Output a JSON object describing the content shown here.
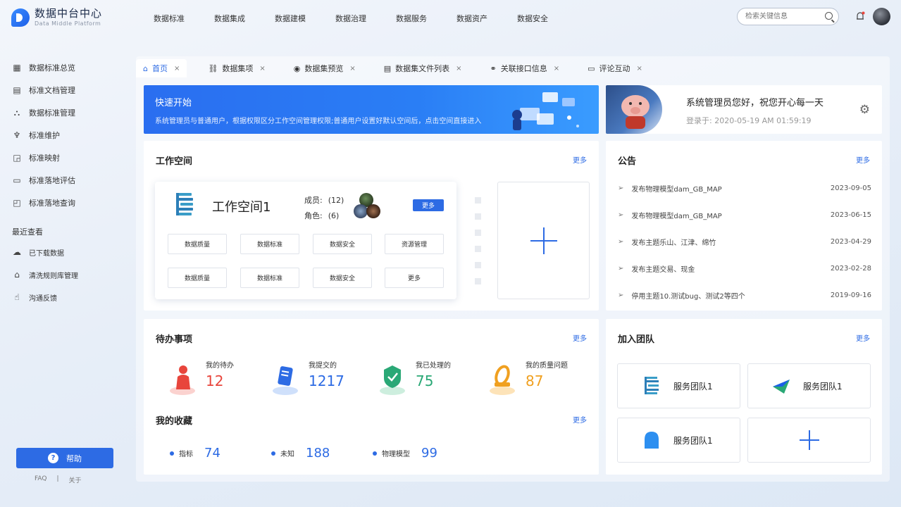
{
  "header": {
    "app_title": "数据中台中心",
    "app_subtitle": "Data Middle Platform",
    "nav": [
      "数据标准",
      "数据集成",
      "数据建模",
      "数据治理",
      "数据服务",
      "数据资产",
      "数据安全"
    ],
    "search_placeholder": "检索关键信息"
  },
  "sidebar": {
    "items": [
      {
        "label": "数据标准总览",
        "icon": "overview-icon"
      },
      {
        "label": "标准文档管理",
        "icon": "document-icon"
      },
      {
        "label": "数据标准管理",
        "icon": "hierarchy-icon"
      },
      {
        "label": "标准维护",
        "icon": "maintenance-icon"
      },
      {
        "label": "标准映射",
        "icon": "mapping-icon"
      },
      {
        "label": "标准落地评估",
        "icon": "comment-icon"
      },
      {
        "label": "标准落地查询",
        "icon": "query-icon"
      }
    ],
    "recent_title": "最近查看",
    "recent": [
      {
        "label": "已下载数据",
        "icon": "cloud-download-icon"
      },
      {
        "label": "清洗规则库管理",
        "icon": "building-icon"
      },
      {
        "label": "沟通反馈",
        "icon": "thumbs-up-icon"
      }
    ],
    "help_label": "帮助",
    "faq_label": "FAQ",
    "sep": "|",
    "about_label": "关于"
  },
  "tabs": [
    {
      "label": "首页",
      "icon": "home-icon"
    },
    {
      "label": "数据集项",
      "icon": "dataset-icon"
    },
    {
      "label": "数据集预览",
      "icon": "eye-icon"
    },
    {
      "label": "数据集文件列表",
      "icon": "file-list-icon"
    },
    {
      "label": "关联接口信息",
      "icon": "link-icon"
    },
    {
      "label": "评论互动",
      "icon": "comment-icon"
    }
  ],
  "tab_close": "×",
  "banner": {
    "title": "快速开始",
    "desc": "系统管理员与普通用户，根据权限区分工作空间管理权限;普通用户设置好默认空间后，点击空间直接进入"
  },
  "welcome": {
    "greeting": "系统管理员您好，祝您开心每一天",
    "login": "登录于: 2020-05-19 AM 01:59:19"
  },
  "workspace": {
    "title": "工作空间",
    "more": "更多",
    "name": "工作空间1",
    "members_label": "成员:",
    "members_value": "(12)",
    "roles_label": "角色:",
    "roles_value": "(6)",
    "more_btn": "更多",
    "buttons_row1": [
      "数据质量",
      "数据标准",
      "数据安全",
      "资源管理"
    ],
    "buttons_row2": [
      "数据质量",
      "数据标准",
      "数据安全",
      "更多"
    ]
  },
  "notice": {
    "title": "公告",
    "more": "更多",
    "items": [
      {
        "text": "发布物理模型dam_GB_MAP",
        "date": "2023-09-05"
      },
      {
        "text": "发布物理模型dam_GB_MAP",
        "date": "2023-06-15"
      },
      {
        "text": "发布主题乐山、江津、绵竹",
        "date": "2023-04-29"
      },
      {
        "text": "发布主题交易、现金",
        "date": "2023-02-28"
      },
      {
        "text": "停用主题10.测试bug、测试2等四个",
        "date": "2019-09-16"
      }
    ]
  },
  "todo": {
    "title": "待办事项",
    "more": "更多",
    "stats": [
      {
        "label": "我的待办",
        "value": "12",
        "color": "#e8453c"
      },
      {
        "label": "我提交的",
        "value": "1217",
        "color": "#2d6be4"
      },
      {
        "label": "我已处理的",
        "value": "75",
        "color": "#2aa876"
      },
      {
        "label": "我的质量问题",
        "value": "87",
        "color": "#f0a020"
      }
    ],
    "fav_title": "我的收藏",
    "fav_more": "更多",
    "favs": [
      {
        "label": "指标",
        "value": "74"
      },
      {
        "label": "未知",
        "value": "188"
      },
      {
        "label": "物理模型",
        "value": "99"
      }
    ]
  },
  "team": {
    "title": "加入团队",
    "more": "更多",
    "cards": [
      {
        "name": "服务团队1"
      },
      {
        "name": "服务团队1"
      },
      {
        "name": "服务团队1"
      }
    ]
  },
  "colors": {
    "accent": "#2d6be4",
    "danger": "#e8453c",
    "success": "#2aa876",
    "warning": "#f0a020"
  }
}
